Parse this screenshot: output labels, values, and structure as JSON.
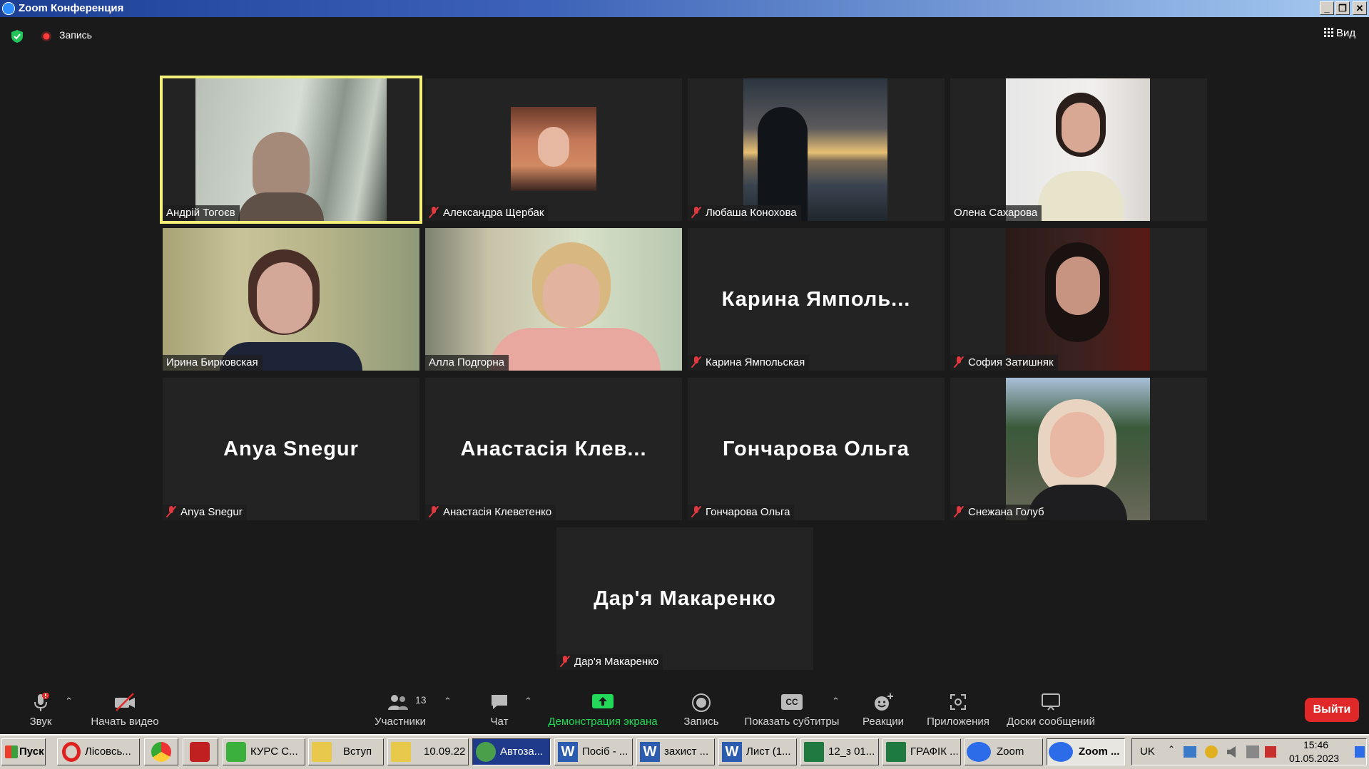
{
  "window": {
    "title": "Zoom Конференция"
  },
  "topbar": {
    "record_label": "Запись",
    "view_label": "Вид"
  },
  "participants": [
    {
      "name": "Андрій Тогоєв",
      "video": true,
      "muted": false,
      "active": true
    },
    {
      "name": "Александра Щербак",
      "video": true,
      "muted": true
    },
    {
      "name": "Любаша  Конохова",
      "video": true,
      "muted": true
    },
    {
      "name": "Олена Сахарова",
      "video": true,
      "muted": false
    },
    {
      "name": "Ирина Бирковская",
      "video": true,
      "muted": false
    },
    {
      "name": "Алла Подгорна",
      "video": true,
      "muted": false
    },
    {
      "name": "Карина Ямпольская",
      "display": "Карина  Ямполь...",
      "video": false,
      "muted": true
    },
    {
      "name": "София Затишняк",
      "video": true,
      "muted": true
    },
    {
      "name": "Anya Snegur",
      "display": "Anya Snegur",
      "video": false,
      "muted": true
    },
    {
      "name": "Анастасія Клеветенко",
      "display": "Анастасія  Клев...",
      "video": false,
      "muted": true
    },
    {
      "name": "Гончарова Ольга",
      "display": "Гончарова Ольга",
      "video": false,
      "muted": true
    },
    {
      "name": "Снежана Голуб",
      "video": true,
      "muted": true
    },
    {
      "name": "Дар'я Макаренко",
      "display": "Дар'я Макаренко",
      "video": false,
      "muted": true
    }
  ],
  "toolbar": {
    "audio": "Звук",
    "video": "Начать видео",
    "participants": "Участники",
    "participants_count": "13",
    "chat": "Чат",
    "share": "Демонстрация экрана",
    "record": "Запись",
    "captions": "Показать субтитры",
    "captions_icon": "CC",
    "reactions": "Реакции",
    "apps": "Приложения",
    "whiteboards": "Доски сообщений",
    "leave": "Выйти",
    "share_color": "#23d959",
    "leave_color": "#e02828"
  },
  "taskbar": {
    "start": "Пуск",
    "items": [
      "Лісовсь...",
      "",
      "",
      "КУРС С...",
      "Вступ",
      "10.09.22",
      "Автоза...",
      "Посіб - ...",
      "захист ...",
      "Лист (1...",
      "12_з 01...",
      "ГРАФІК ...",
      "Zoom",
      "Zoom ..."
    ],
    "lang": "UK",
    "time": "15:46",
    "date": "01.05.2023"
  }
}
